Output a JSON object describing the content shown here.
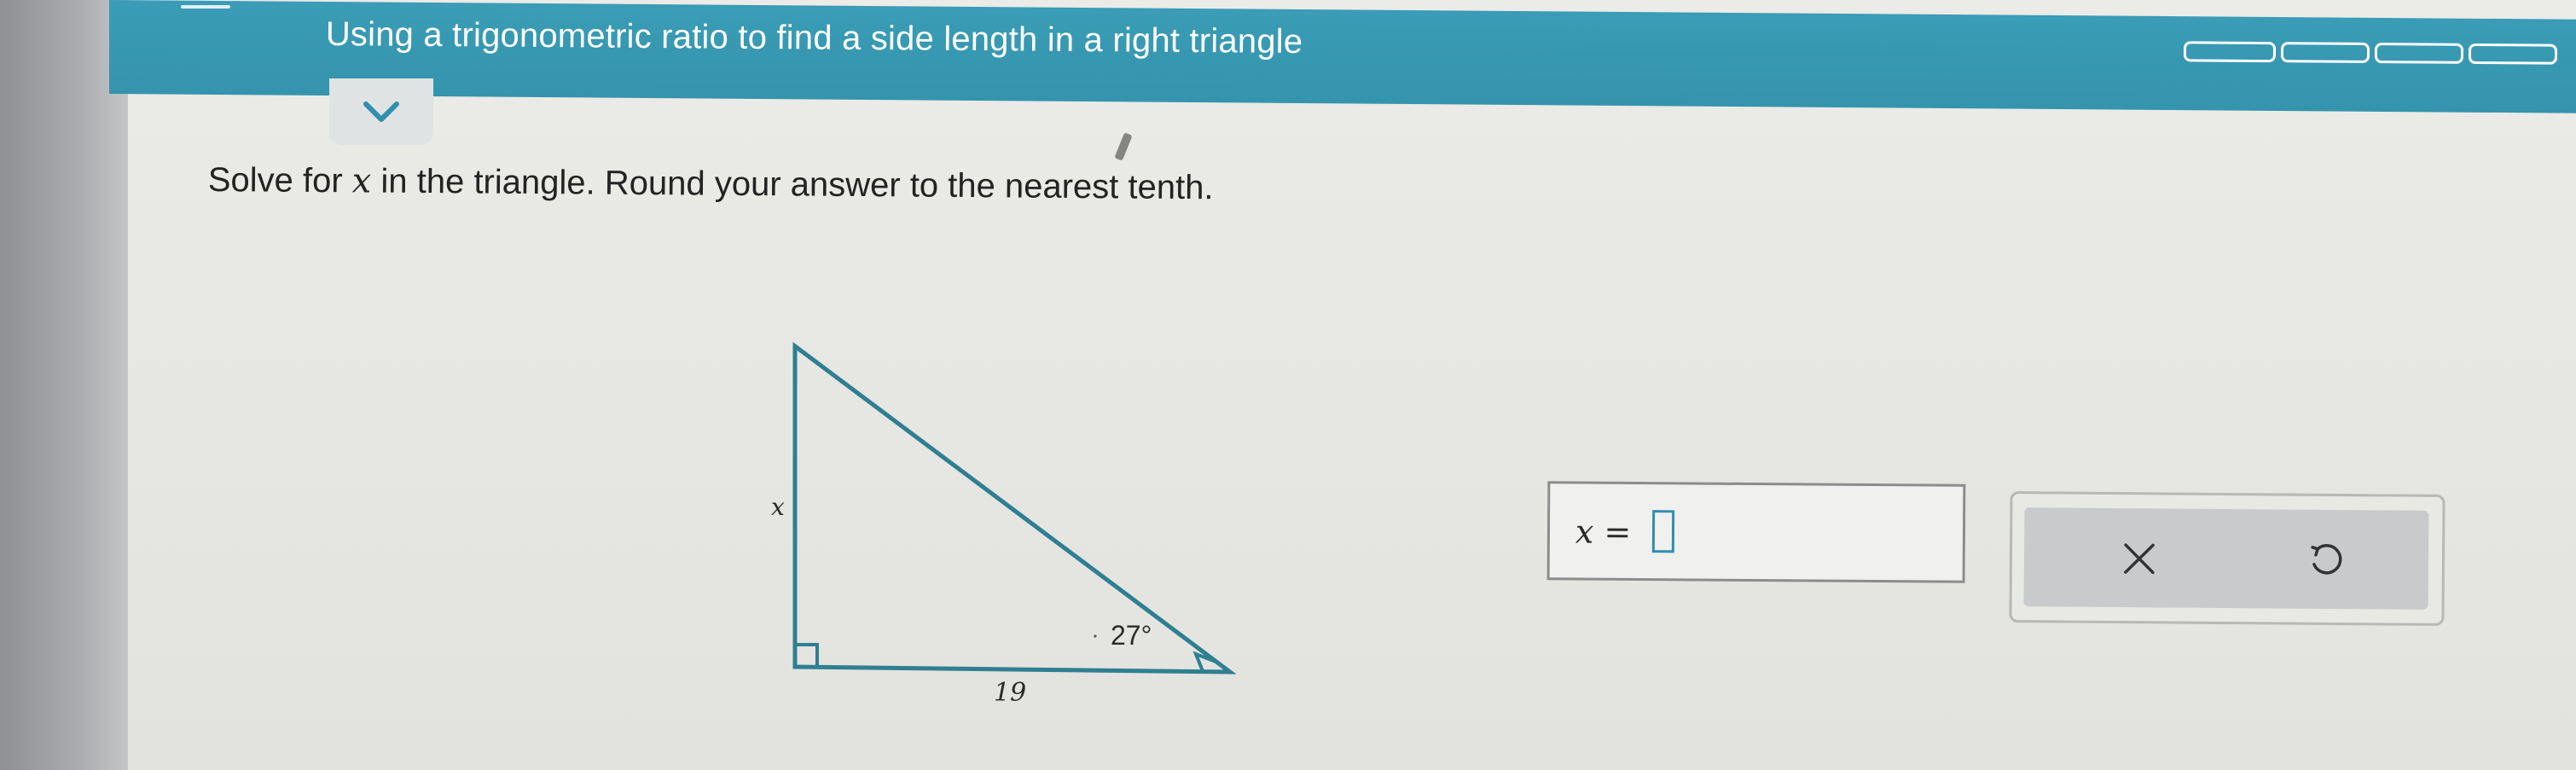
{
  "header": {
    "title": "Using a trigonometric ratio to find a side length in a right triangle",
    "progress_segments": 4,
    "color": "#3a9cb6"
  },
  "question": {
    "prefix": "Solve for ",
    "variable": "x",
    "suffix": " in the triangle. Round your answer to the nearest tenth."
  },
  "triangle": {
    "side_label": "x",
    "base_label": "19",
    "angle_label": "27°"
  },
  "answer": {
    "variable": "x",
    "equals": "=",
    "value": ""
  },
  "icons": {
    "collapse": "chevron-down-icon",
    "clear": "close-icon",
    "undo": "undo-icon"
  },
  "colors": {
    "accent": "#3a9cb6",
    "triangle_stroke": "#2e7f91"
  }
}
